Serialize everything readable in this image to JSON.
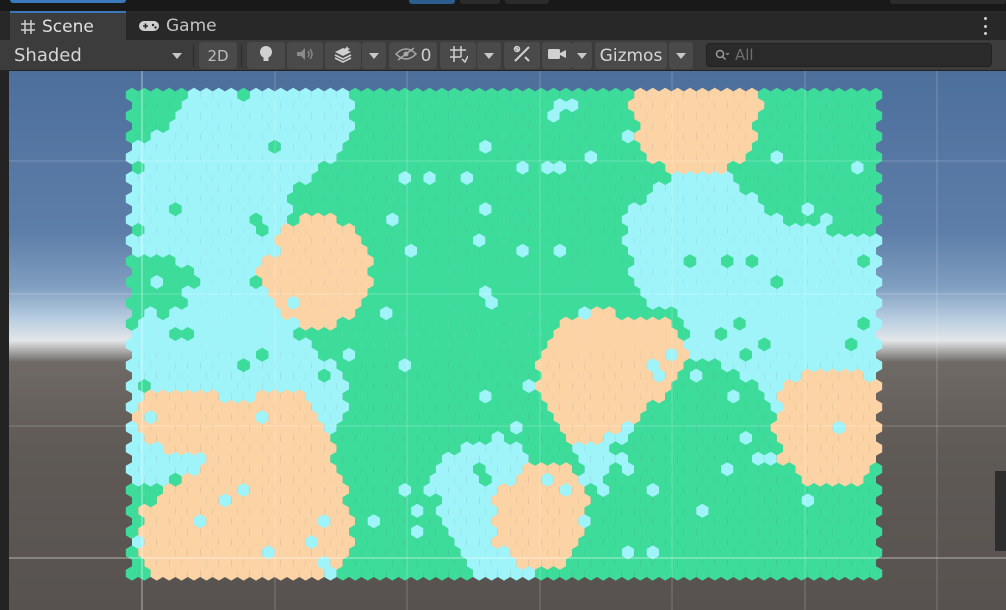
{
  "tabs": [
    {
      "label": "Scene",
      "icon": "grid-icon",
      "active": true
    },
    {
      "label": "Game",
      "icon": "gamepad-icon",
      "active": false
    }
  ],
  "toolbar": {
    "shading_mode": "Shaded",
    "mode_2d_label": "2D",
    "hidden_count": "0",
    "gizmos_label": "Gizmos",
    "search_placeholder": "All",
    "icons": [
      "lightbulb-icon",
      "audio-icon",
      "effects-icon",
      "visibility-icon",
      "grid-snap-icon",
      "tools-icon",
      "camera-icon",
      "search-icon"
    ]
  },
  "scene": {
    "hex_map": {
      "terrain_colors": {
        "grass": "#3ddc9b",
        "water": "#9ff4fa",
        "sand": "#fbd3a5",
        "rock": "#b4e6f4"
      }
    }
  },
  "colors": {
    "accent": "#3a79bb",
    "tab_active_bg": "#3c3c3c",
    "toolbar_bg": "#3c3c3c",
    "sky": "#5d7ea8",
    "ground": "#5f5a56"
  }
}
